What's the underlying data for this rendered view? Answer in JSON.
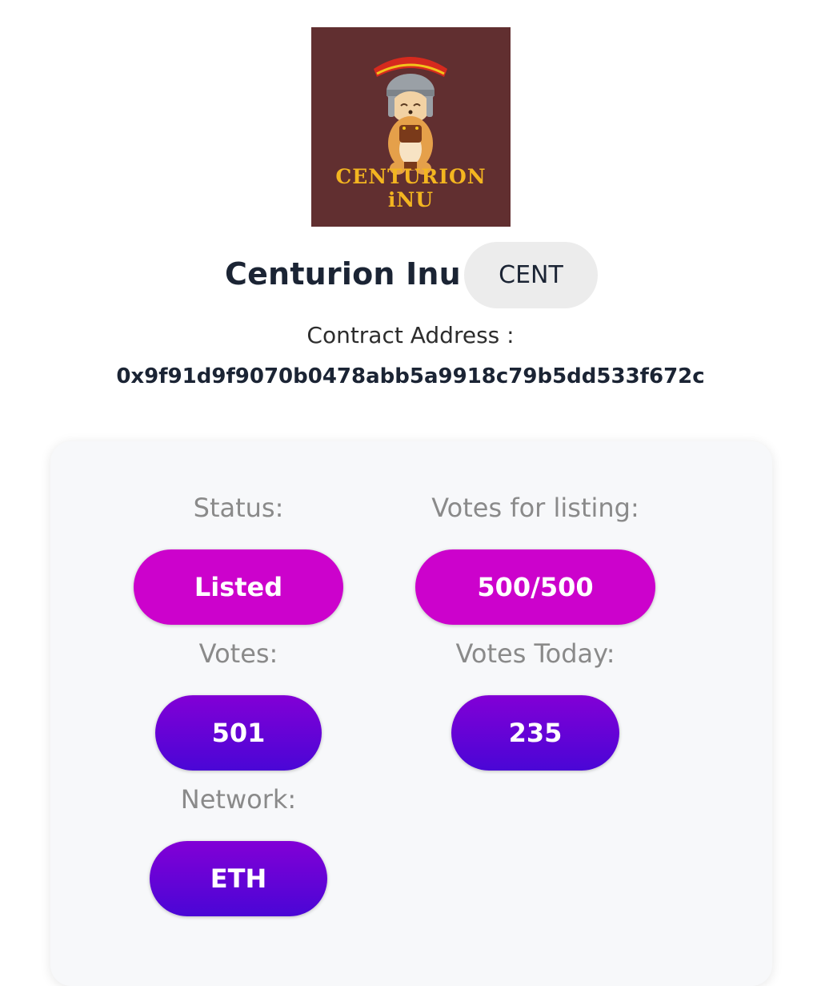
{
  "token": {
    "logo_text": "CENTURION iNU",
    "name": "Centurion Inu",
    "ticker": "CENT",
    "contract_label": "Contract Address :",
    "contract_address": "0x9f91d9f9070b0478abb5a9918c79b5dd533f672c"
  },
  "stats": {
    "status": {
      "label": "Status:",
      "value": "Listed"
    },
    "votes_for_listing": {
      "label": "Votes for listing:",
      "value": "500/500"
    },
    "votes": {
      "label": "Votes:",
      "value": "501"
    },
    "votes_today": {
      "label": "Votes Today:",
      "value": "235"
    },
    "network": {
      "label": "Network:",
      "value": "ETH"
    }
  },
  "colors": {
    "logo_background": "#612f30",
    "status_pill": "#cc02cc",
    "count_pill_top": "#8200d6",
    "count_pill_bottom": "#4a06d6"
  },
  "icons": {
    "logo": "shiba-dog-centurion-helmet-icon"
  }
}
